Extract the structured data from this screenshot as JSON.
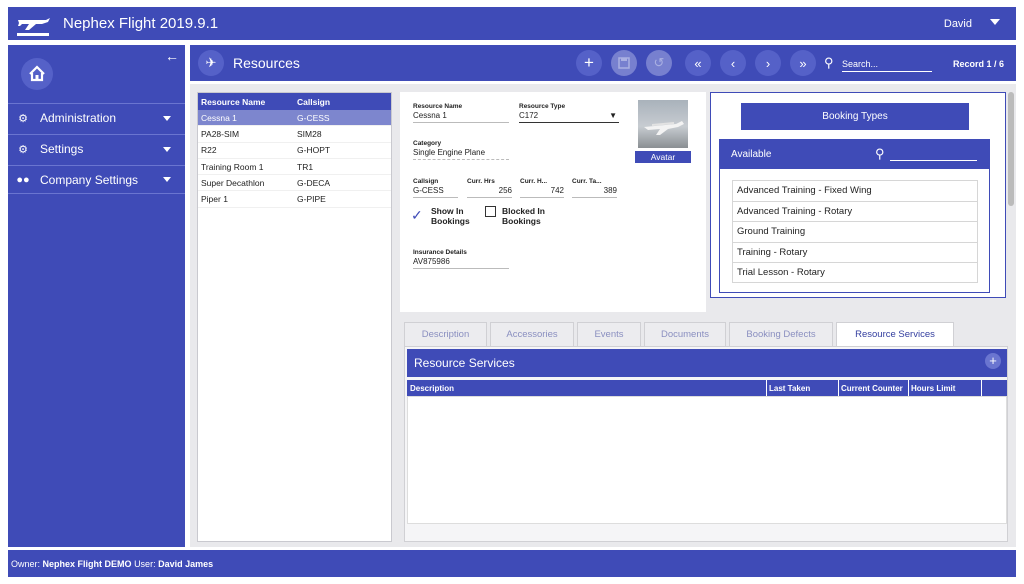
{
  "app": {
    "title": "Nephex Flight 2019.9.1",
    "user": "David"
  },
  "sidebar": {
    "items": [
      {
        "label": "Administration",
        "icon": "gear-icon"
      },
      {
        "label": "Settings",
        "icon": "gears-icon"
      },
      {
        "label": "Company Settings",
        "icon": "users-icon"
      }
    ]
  },
  "toolbar": {
    "title": "Resources",
    "search_placeholder": "Search...",
    "record": "Record 1 / 6"
  },
  "resources": {
    "headers": [
      "Resource Name",
      "Callsign"
    ],
    "rows": [
      {
        "name": "Cessna 1",
        "callsign": "G-CESS"
      },
      {
        "name": "PA28-SIM",
        "callsign": "SIM28"
      },
      {
        "name": "R22",
        "callsign": "G-HOPT"
      },
      {
        "name": "Training Room 1",
        "callsign": "TR1"
      },
      {
        "name": "Super Decathlon",
        "callsign": "G-DECA"
      },
      {
        "name": "Piper 1",
        "callsign": "G-PIPE"
      }
    ]
  },
  "detail": {
    "resource_name_label": "Resource Name",
    "resource_name": "Cessna 1",
    "resource_type_label": "Resource Type",
    "resource_type": "C172",
    "category_label": "Category",
    "category": "Single Engine Plane",
    "callsign_label": "Callsign",
    "callsign": "G-CESS",
    "curr_hrs_label": "Curr. Hrs",
    "curr_hrs": "256",
    "curr_h_label": "Curr. H...",
    "curr_h": "742",
    "curr_ta_label": "Curr. Ta...",
    "curr_ta": "389",
    "show_in_bookings": "Show In Bookings",
    "blocked_in_bookings": "Blocked In Bookings",
    "insurance_label": "Insurance Details",
    "insurance": "AV875986",
    "avatar_label": "Avatar"
  },
  "booking_types": {
    "button": "Booking Types",
    "available_label": "Available",
    "items": [
      "Advanced Training - Fixed Wing",
      "Advanced Training - Rotary",
      "Ground Training",
      "Training - Rotary",
      "Trial Lesson - Rotary"
    ]
  },
  "tabs": [
    "Description",
    "Accessories",
    "Events",
    "Documents",
    "Booking Defects",
    "Resource Services"
  ],
  "resource_services": {
    "title": "Resource Services",
    "columns": [
      "Description",
      "Last Taken",
      "Current Counter",
      "Hours Limit"
    ]
  },
  "footer": {
    "owner_label": "Owner:",
    "owner": "Nephex Flight DEMO",
    "user_label": "User:",
    "user": "David James"
  },
  "colors": {
    "primary": "#3f4bb7",
    "selected_row": "#7d86ce"
  }
}
